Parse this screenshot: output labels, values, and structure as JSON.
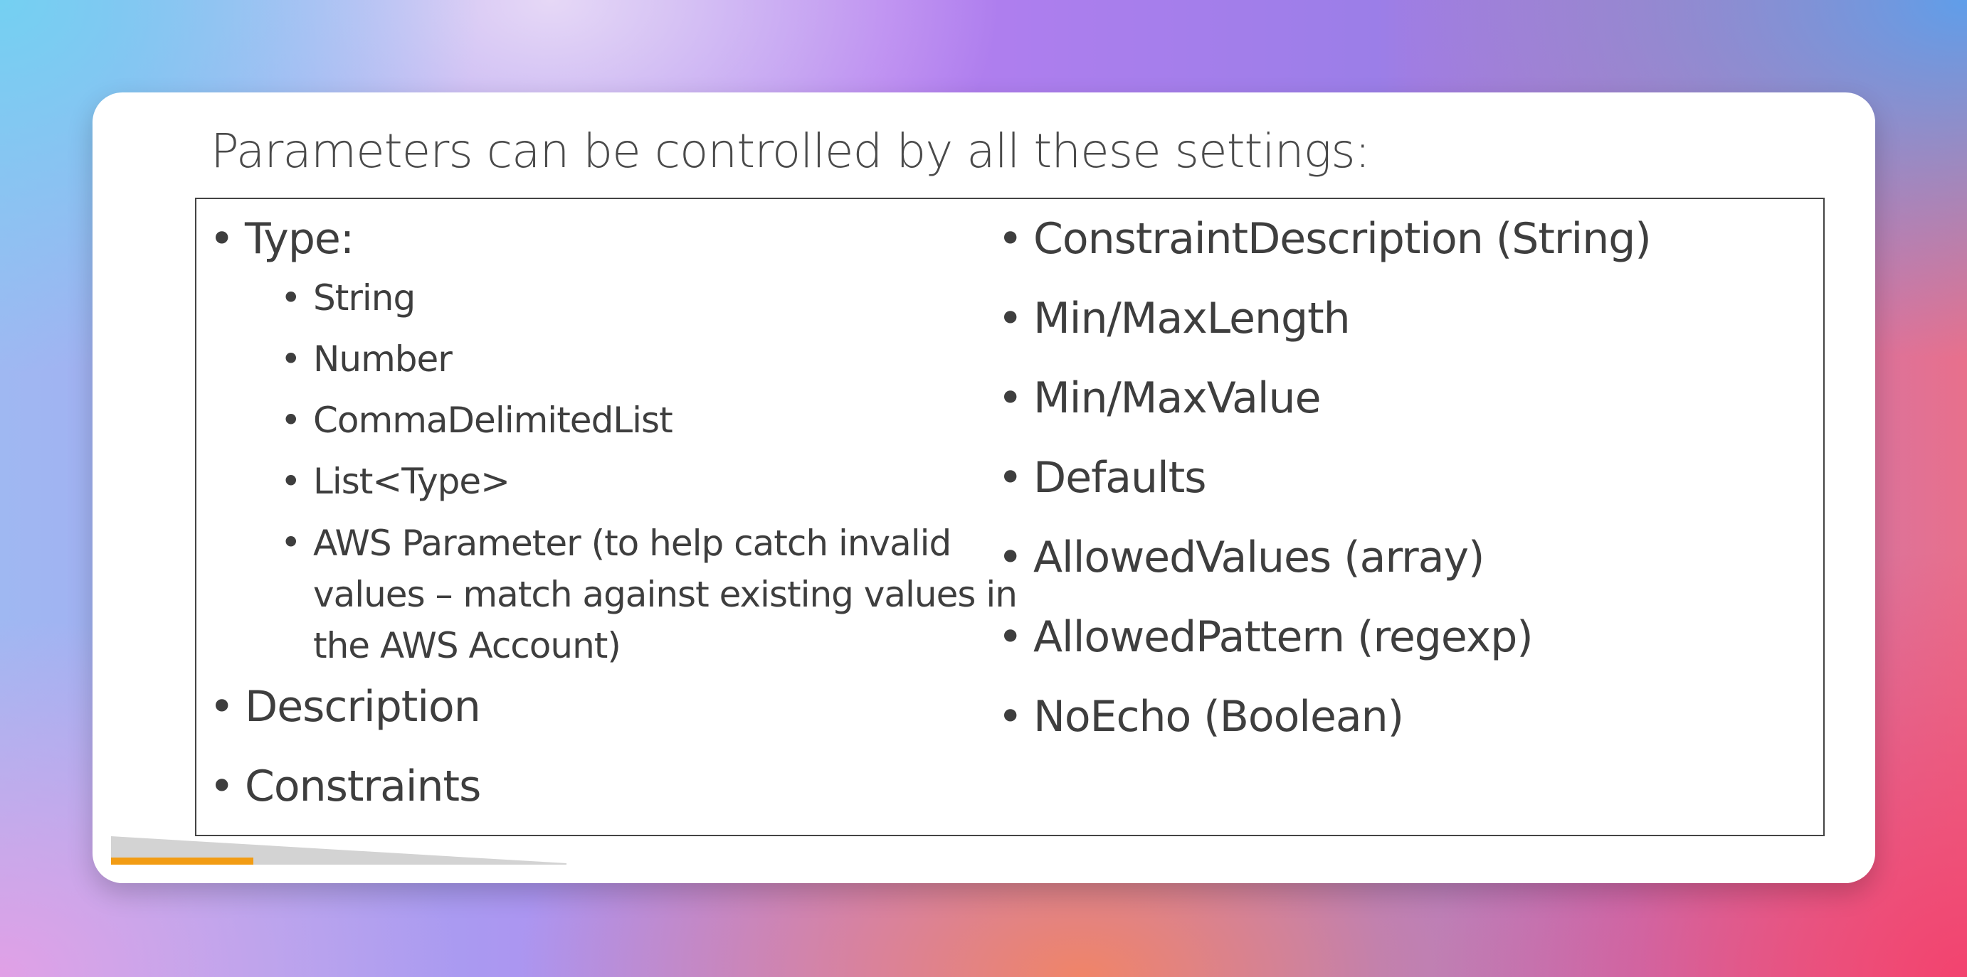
{
  "slide": {
    "title": "Parameters can be controlled by all these settings:",
    "bullet_glyph": "•",
    "left_column": {
      "type_heading": "Type:",
      "type_subitems": [
        "String",
        "Number",
        "CommaDelimitedList",
        "List<Type>",
        "AWS Parameter (to help catch invalid values – match against existing values in the AWS Account)"
      ],
      "description": "Description",
      "constraints": "Constraints"
    },
    "right_column": {
      "items": [
        "ConstraintDescription (String)",
        "Min/MaxLength",
        "Min/MaxValue",
        "Defaults",
        "AllowedValues (array)",
        "AllowedPattern (regexp)",
        "NoEcho (Boolean)"
      ]
    }
  },
  "colors": {
    "text": "#3e3e3e",
    "accent_orange": "#f29c14",
    "accent_gray": "#d3d3d3"
  }
}
